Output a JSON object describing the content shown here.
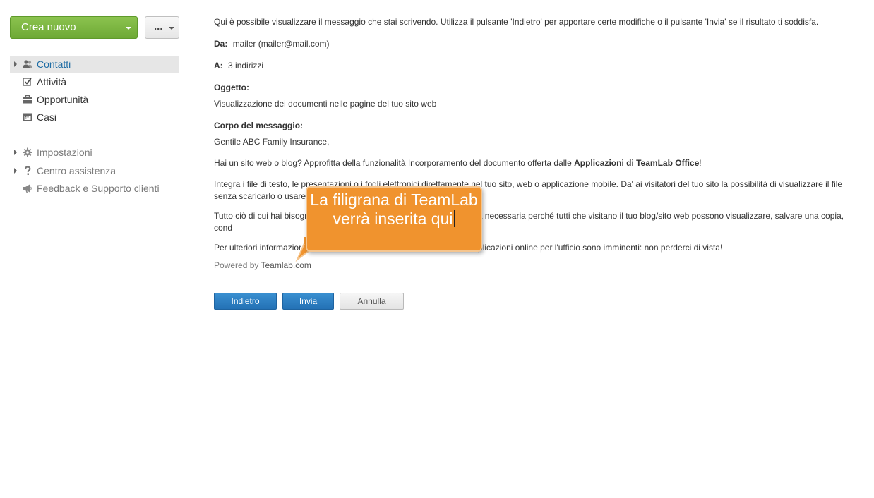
{
  "sidebar": {
    "create_button": "Crea nuovo",
    "more_button": "...",
    "items": [
      {
        "label": "Contatti",
        "icon": "contacts-icon"
      },
      {
        "label": "Attività",
        "icon": "task-check-icon"
      },
      {
        "label": "Opportunità",
        "icon": "briefcase-icon"
      },
      {
        "label": "Casi",
        "icon": "calendar-icon"
      }
    ],
    "secondary": [
      {
        "label": "Impostazioni",
        "icon": "gear-icon"
      },
      {
        "label": "Centro assistenza",
        "icon": "question-icon"
      },
      {
        "label": "Feedback e Supporto clienti",
        "icon": "megaphone-icon"
      }
    ]
  },
  "preview": {
    "intro": "Qui è possibile visualizzare il messaggio che stai scrivendo. Utilizza il pulsante 'Indietro' per apportare certe modifiche o il pulsante 'Invia' se il risultato ti soddisfa.",
    "from_label": "Da:",
    "from_value": "mailer (mailer@mail.com)",
    "to_label": "A:",
    "to_value": "3 indirizzi",
    "subject_label": "Oggetto:",
    "subject_value": "Visualizzazione dei documenti nelle pagine del tuo sito web",
    "body_label": "Corpo del messaggio:",
    "greeting": "Gentile ABC Family Insurance,",
    "p1_text": "Hai un sito web o blog? Approfitta della funzionalità Incorporamento del documento offerta dalle ",
    "p1_bold": "Applicazioni di TeamLab Office",
    "p1_end": "!",
    "p2": "Integra i file di testo, le presentazioni o i fogli elettronici direttamente nel tuo sito, web o applicazione mobile. Da' ai visitatori del tuo sito la possibilità di visualizzare il file senza scaricarlo o usare",
    "p3": "Tutto ciò di cui hai bisogno è generare il codice e inserirlo in una pagina necessaria perché tutti che visitano il tuo blog/sito web possono visualizzare, salvare una copia, cond",
    "p4_start": "Per ulteriori informazior",
    "p4_end": "plicazioni online per l'ufficio sono imminenti: non perderci di vista!",
    "powered_by": "Powered by",
    "powered_link": "Teamlab.com"
  },
  "actions": {
    "back": "Indietro",
    "send": "Invia",
    "cancel": "Annulla"
  },
  "callout": {
    "text": "La filigrana di TeamLab verrà inserita qui"
  },
  "colors": {
    "create_green": "#7ab541",
    "primary_blue": "#2a7bbf",
    "active_link": "#1f6da5",
    "callout_orange": "#f0932e"
  }
}
